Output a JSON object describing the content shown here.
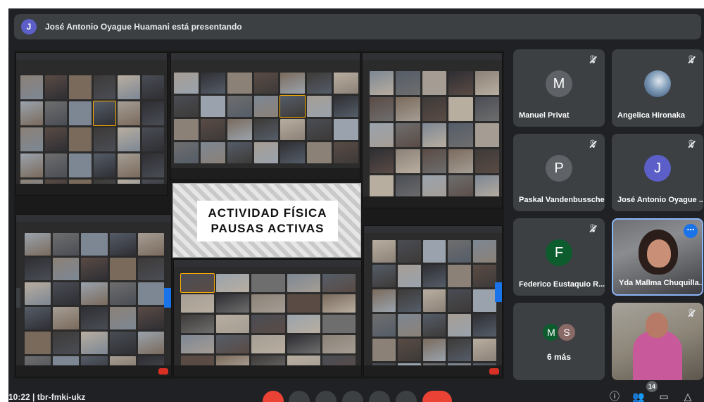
{
  "presenting": {
    "avatar_letter": "J",
    "text": "José Antonio Oyague Huamani está presentando"
  },
  "slide": {
    "line1": "ACTIVIDAD  FÍSICA",
    "line2": "PAUSAS ACTIVAS"
  },
  "participants": [
    {
      "name": "Manuel Privat",
      "avatar": "M",
      "color": "#5f6368",
      "muted": true
    },
    {
      "name": "Angelica Hironaka",
      "avatar": "",
      "color": "#4a6b8a",
      "muted": true
    },
    {
      "name": "Paskal Vandenbussche",
      "avatar": "P",
      "color": "#5f6368",
      "muted": true
    },
    {
      "name": "José Antonio Oyague ...",
      "avatar": "J",
      "color": "#5b5fc7",
      "muted": true
    },
    {
      "name": "Federico Eustaquio R...",
      "avatar": "F",
      "color": "#0d5c2e",
      "muted": true
    },
    {
      "name": "Yda Mallma Chuquilla...",
      "avatar": "",
      "color": "",
      "muted": false
    }
  ],
  "more": {
    "avatar_1": "M",
    "avatar_2": "S",
    "label": "6 más"
  },
  "toolbar": {
    "time": "10:22  |  tbr-fmki-ukz",
    "participant_count": "14"
  },
  "colors": {
    "background": "#202124",
    "tile": "#3c4043",
    "accent": "#1a73e8",
    "danger": "#ea4335"
  }
}
